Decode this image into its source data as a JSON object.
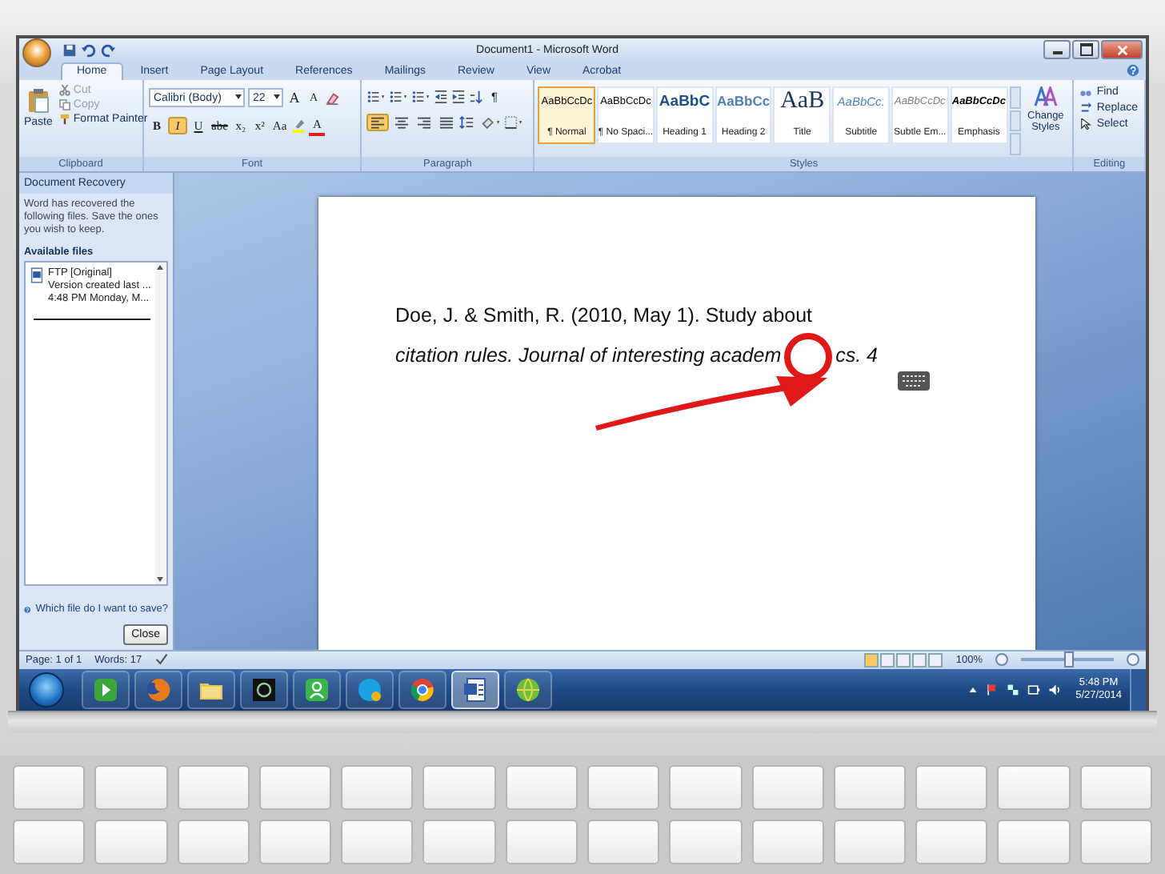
{
  "window": {
    "title": "Document1 - Microsoft Word"
  },
  "tabs": [
    {
      "label": "Home",
      "selected": true
    },
    {
      "label": "Insert",
      "selected": false
    },
    {
      "label": "Page Layout",
      "selected": false
    },
    {
      "label": "References",
      "selected": false
    },
    {
      "label": "Mailings",
      "selected": false
    },
    {
      "label": "Review",
      "selected": false
    },
    {
      "label": "View",
      "selected": false
    },
    {
      "label": "Acrobat",
      "selected": false
    }
  ],
  "clipboard": {
    "label": "Clipboard",
    "paste": "Paste",
    "commands": [
      {
        "label": "Cut",
        "kind": "cut",
        "disabled": true
      },
      {
        "label": "Copy",
        "kind": "copy",
        "disabled": true
      },
      {
        "label": "Format Painter",
        "kind": "painter",
        "disabled": false
      }
    ]
  },
  "font": {
    "label": "Font",
    "family": "Calibri (Body)",
    "size": "22",
    "grow": "A",
    "shrink": "A",
    "color_button": "A",
    "formats": [
      {
        "label": "B",
        "kind": "bold",
        "on": false
      },
      {
        "label": "I",
        "kind": "italic",
        "on": true
      },
      {
        "label": "U",
        "kind": "underline",
        "on": false
      },
      {
        "label": "abe",
        "kind": "strike",
        "on": false
      },
      {
        "label": "x₂",
        "kind": "sub",
        "on": false
      },
      {
        "label": "x²",
        "kind": "sup",
        "on": false
      },
      {
        "label": "Aa",
        "kind": "case",
        "on": false
      }
    ]
  },
  "paragraph": {
    "label": "Paragraph",
    "marks_button": "¶",
    "alignments": [
      {
        "selected": true
      },
      {
        "selected": false
      },
      {
        "selected": false
      },
      {
        "selected": false
      }
    ]
  },
  "styles": {
    "label": "Styles",
    "change": "Change Styles",
    "items": [
      {
        "preview": "AaBbCcDc",
        "label": "¶ Normal",
        "kind": "normal",
        "selected": true
      },
      {
        "preview": "AaBbCcDc",
        "label": "¶ No Spaci...",
        "kind": "normal",
        "selected": false
      },
      {
        "preview": "AaBbC",
        "label": "Heading 1",
        "kind": "heading1",
        "selected": false
      },
      {
        "preview": "AaBbCc",
        "label": "Heading 2",
        "kind": "heading2",
        "selected": false
      },
      {
        "preview": "AaB",
        "label": "Title",
        "kind": "title",
        "selected": false
      },
      {
        "preview": "AaBbCc.",
        "label": "Subtitle",
        "kind": "subtitle",
        "selected": false
      },
      {
        "preview": "AaBbCcDc",
        "label": "Subtle Em...",
        "kind": "subtle",
        "selected": false
      },
      {
        "preview": "AaBbCcDc",
        "label": "Emphasis",
        "kind": "emphasis",
        "selected": false
      }
    ]
  },
  "editing": {
    "label": "Editing",
    "commands": [
      {
        "label": "Find",
        "kind": "find"
      },
      {
        "label": "Replace",
        "kind": "replace"
      },
      {
        "label": "Select",
        "kind": "select"
      }
    ]
  },
  "recovery": {
    "title": "Document Recovery",
    "message": "Word has recovered the following files.  Save the ones you wish to keep.",
    "files_heading": "Available files",
    "files": [
      {
        "name": "FTP  [Original]",
        "detail": "Version created last ...",
        "time": "4:48 PM Monday, M..."
      }
    ],
    "help_link": "Which file do I want to save?",
    "close": "Close"
  },
  "document": {
    "lines": [
      {
        "segments": [
          "Doe, J. & Smith, R. (2010, May 1). Study about"
        ],
        "italic": false
      },
      {
        "segments": [
          "citation rules. Journal of interesting academ",
          "cs. 4"
        ],
        "italic": true
      }
    ]
  },
  "status_bar": {
    "page": "Page: 1 of 1",
    "words": "Words: 17",
    "zoom": "100%",
    "zoom_slider": {
      "level": 0.5
    }
  },
  "taskbar": {
    "apps": [
      {
        "kind": "media",
        "active": false
      },
      {
        "kind": "firefox",
        "active": false
      },
      {
        "kind": "folder",
        "active": false
      },
      {
        "kind": "camera",
        "active": false
      },
      {
        "kind": "contacts",
        "active": false
      },
      {
        "kind": "skype",
        "active": false
      },
      {
        "kind": "chrome",
        "active": false
      },
      {
        "kind": "word",
        "active": true
      },
      {
        "kind": "globe",
        "active": false
      }
    ],
    "time": "5:48 PM",
    "date": "5/27/2014"
  }
}
